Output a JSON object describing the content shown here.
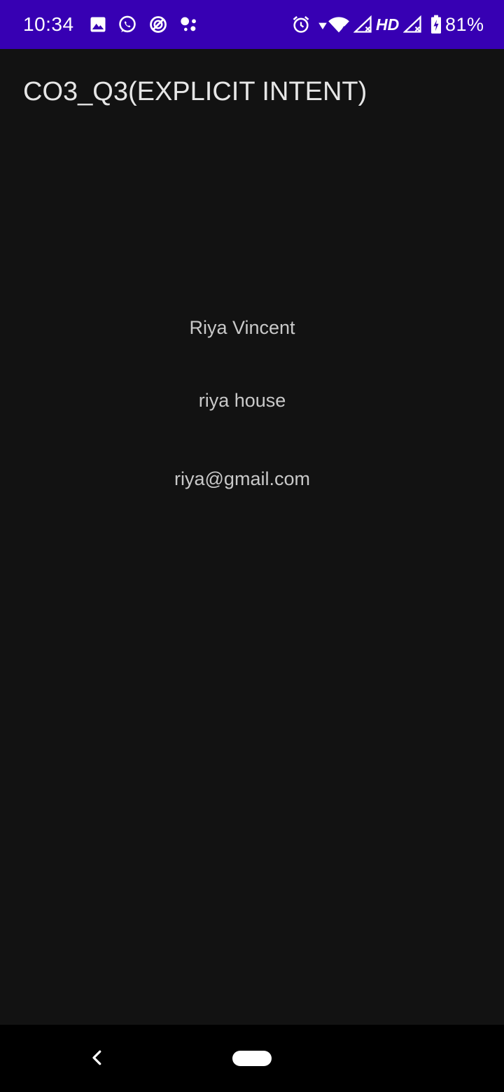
{
  "status_bar": {
    "time": "10:34",
    "network_label": "HD",
    "battery_percent": "81%",
    "background_color": "#3700b3",
    "icons": [
      "image-icon",
      "whatsapp-icon",
      "data-saver-icon",
      "assistant-dots-icon",
      "alarm-icon",
      "wifi-icon",
      "signal-icon",
      "signal-2-icon",
      "battery-charging-icon"
    ]
  },
  "app_bar": {
    "title": "CO3_Q3(EXPLICIT INTENT)"
  },
  "content": {
    "name": "Riya Vincent",
    "address": "riya house",
    "email": "riya@gmail.com"
  },
  "nav_bar": {
    "icons": [
      "back-icon",
      "home-pill-icon"
    ]
  }
}
